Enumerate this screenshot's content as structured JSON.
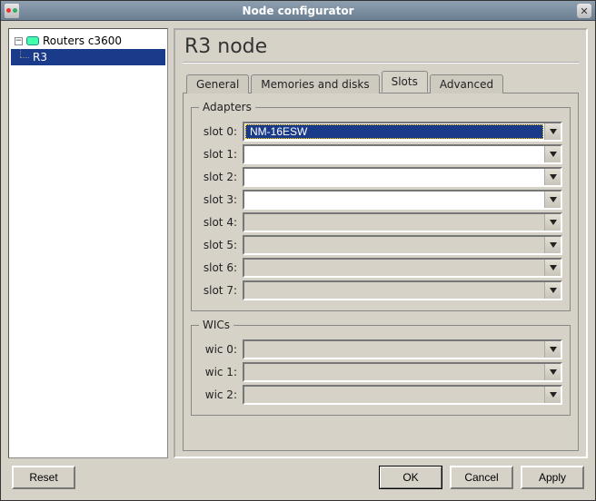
{
  "window": {
    "title": "Node configurator"
  },
  "tree": {
    "root": {
      "label": "Routers c3600",
      "expanded": true
    },
    "child": {
      "label": "R3",
      "selected": true
    }
  },
  "heading": "R3 node",
  "tabs": {
    "general": "General",
    "memories": "Memories and disks",
    "slots": "Slots",
    "advanced": "Advanced",
    "active": "slots"
  },
  "groups": {
    "adapters": "Adapters",
    "wics": "WICs"
  },
  "slots": [
    {
      "label": "slot 0:",
      "value": "NM-16ESW",
      "selected": true,
      "editable": true
    },
    {
      "label": "slot 1:",
      "value": "",
      "selected": false,
      "editable": true
    },
    {
      "label": "slot 2:",
      "value": "",
      "selected": false,
      "editable": true
    },
    {
      "label": "slot 3:",
      "value": "",
      "selected": false,
      "editable": true
    },
    {
      "label": "slot 4:",
      "value": "",
      "selected": false,
      "editable": false
    },
    {
      "label": "slot 5:",
      "value": "",
      "selected": false,
      "editable": false
    },
    {
      "label": "slot 6:",
      "value": "",
      "selected": false,
      "editable": false
    },
    {
      "label": "slot 7:",
      "value": "",
      "selected": false,
      "editable": false
    }
  ],
  "wics": [
    {
      "label": "wic 0:",
      "value": ""
    },
    {
      "label": "wic 1:",
      "value": ""
    },
    {
      "label": "wic 2:",
      "value": ""
    }
  ],
  "buttons": {
    "reset": "Reset",
    "ok": "OK",
    "cancel": "Cancel",
    "apply": "Apply"
  }
}
